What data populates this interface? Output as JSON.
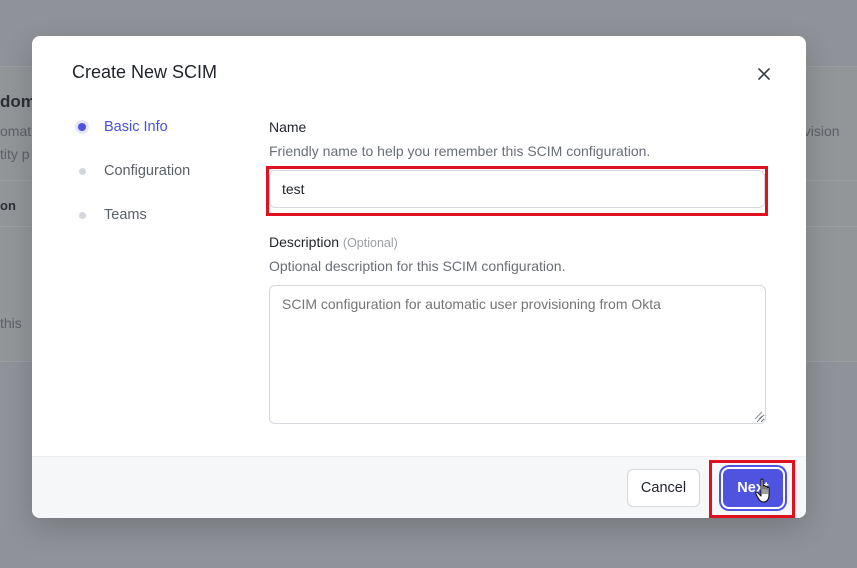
{
  "background": {
    "title": "dom",
    "description_line1": "omat",
    "description_line2": "tity p",
    "right_text": "ovision",
    "column_header": "on",
    "empty_text": "this"
  },
  "modal": {
    "title": "Create New SCIM",
    "close_icon": "close-icon"
  },
  "steps": [
    {
      "label": "Basic Info",
      "state": "active"
    },
    {
      "label": "Configuration",
      "state": "pending"
    },
    {
      "label": "Teams",
      "state": "pending"
    }
  ],
  "form": {
    "name": {
      "label": "Name",
      "help": "Friendly name to help you remember this SCIM configuration.",
      "value": "test"
    },
    "description": {
      "label": "Description",
      "optional_tag": "(Optional)",
      "help": "Optional description for this SCIM configuration.",
      "placeholder": "SCIM configuration for automatic user provisioning from Okta",
      "value": ""
    }
  },
  "footer": {
    "cancel_label": "Cancel",
    "next_label": "Next"
  },
  "colors": {
    "accent": "#4f54e0",
    "annotation": "#e0101e"
  }
}
